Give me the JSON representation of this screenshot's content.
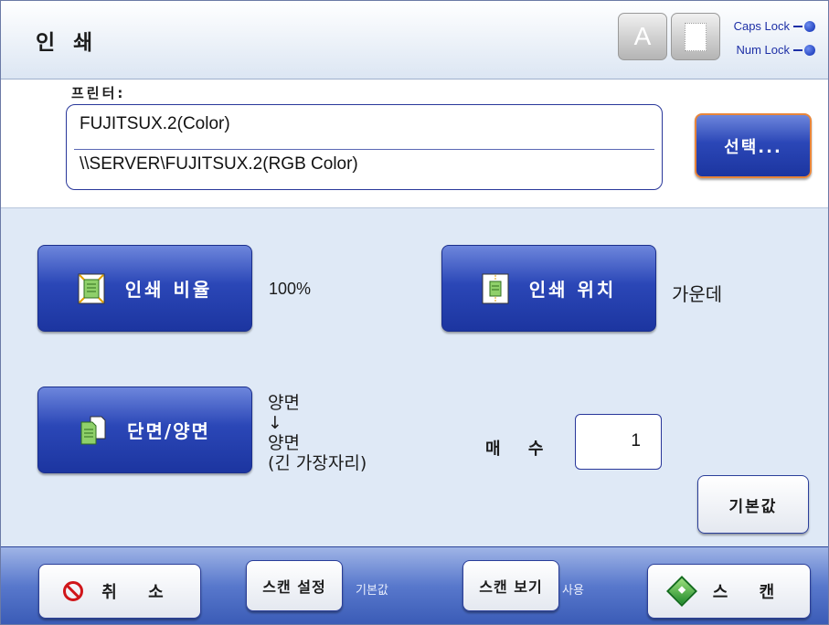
{
  "window": {
    "title": "인 쇄",
    "indicators": {
      "caps_key": "A",
      "caps_lock": "Caps Lock",
      "num_lock": "Num Lock"
    }
  },
  "printer": {
    "label": "프린터:",
    "name": "FUJITSUX.2(Color)",
    "path": "\\\\SERVER\\FUJITSUX.2(RGB Color)",
    "select_button": "선택..."
  },
  "settings": {
    "ratio_button": "인쇄 비율",
    "ratio_value": "100%",
    "position_button": "인쇄 위치",
    "position_value": "가운데",
    "duplex_button": "단면/양면",
    "duplex_value": [
      "양면",
      "↓",
      "양면",
      "(긴 가장자리)"
    ],
    "copies_label": "매 수",
    "copies_value": "1",
    "default_button": "기본값"
  },
  "footer": {
    "cancel_button": "취 소",
    "scan_settings_button": "스캔 설정",
    "scan_settings_note": "기본값",
    "scan_view_button": "스캔 보기",
    "scan_view_note": "사용",
    "scan_button": "스 캔"
  },
  "colors": {
    "button_blue": "#2b47b7",
    "accent_orange": "#e8853a",
    "footer_blue": "#5878cc"
  }
}
